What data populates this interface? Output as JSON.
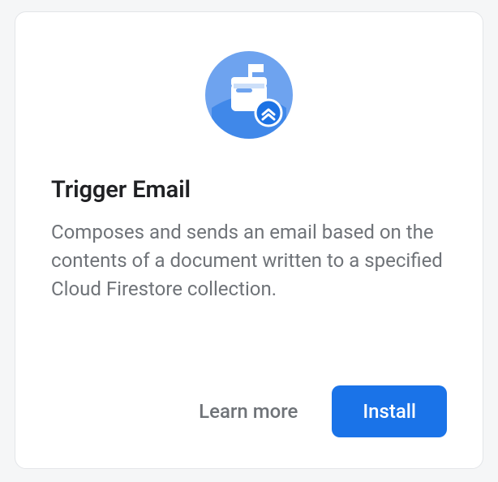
{
  "icon": {
    "name": "trigger-email-mailbox-icon",
    "colors": {
      "circle_light": "#6ea3ef",
      "circle_dark": "#1c72e4",
      "mailbox": "#ffffff",
      "badge_fill": "#1c72e4",
      "badge_stroke": "#ffffff"
    }
  },
  "title": "Trigger Email",
  "description": "Composes and sends an email based on the contents of a document written to a specified Cloud Firestore collection.",
  "actions": {
    "learn_more": "Learn more",
    "install": "Install"
  }
}
